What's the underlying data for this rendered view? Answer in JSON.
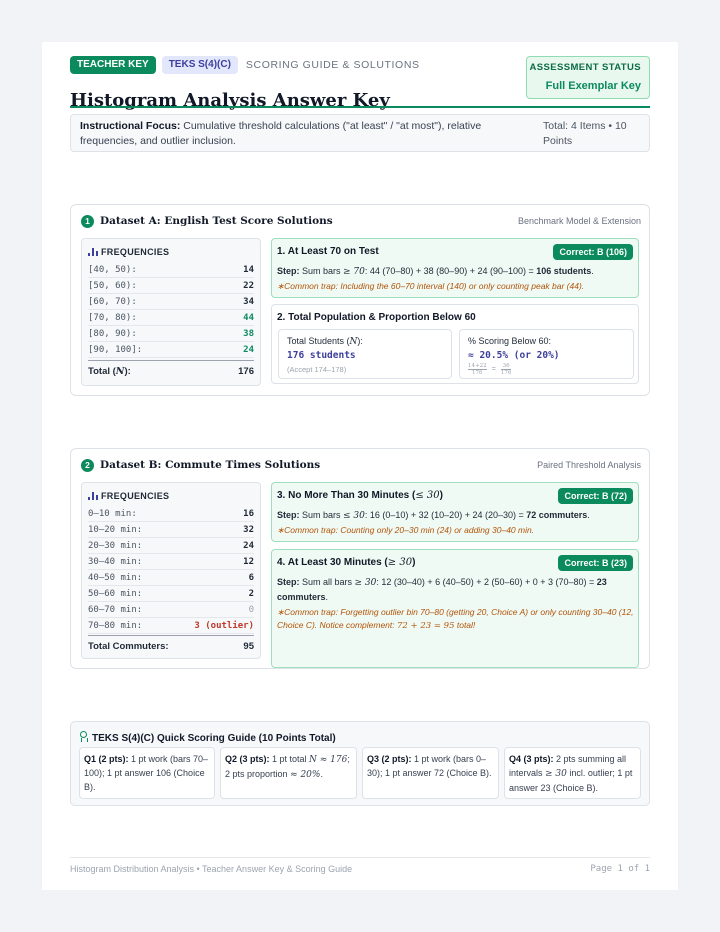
{
  "header": {
    "tag_teacher": "TEACHER KEY",
    "tag_teks": "TEKS S(4)(C)",
    "caption": "SCORING GUIDE & SOLUTIONS",
    "title": "Histogram Analysis Answer Key",
    "status_label": "ASSESSMENT STATUS",
    "status_value": "Full Exemplar Key"
  },
  "focus": {
    "label": "Instructional Focus:",
    "text": " Cumulative threshold calculations (\"at least\" / \"at most\"), relative frequencies, and outlier inclusion.",
    "total": "Total: 4 Items • 10 Points"
  },
  "colors": {
    "accent": "#0b8a5e",
    "indigo": "#3d3f9e",
    "trap": "#b45309",
    "outlier": "#c0392b"
  },
  "icons": [
    "bar-chart-icon",
    "medal-icon"
  ],
  "dataset_a": {
    "number": "1",
    "title": "Dataset A: English Test Score Solutions",
    "note": "Benchmark Model & Extension",
    "freq_heading": "FREQUENCIES",
    "rows": [
      {
        "label": "[40, 50):",
        "value": "14"
      },
      {
        "label": "[50, 60):",
        "value": "22"
      },
      {
        "label": "[60, 70):",
        "value": "34"
      },
      {
        "label": "[70, 80):",
        "value": "44"
      },
      {
        "label": "[80, 90):",
        "value": "38"
      },
      {
        "label": "[90, 100]:",
        "value": "24"
      }
    ],
    "total_label": "Total (",
    "total_var": "N",
    "total_label_end": "):",
    "total_value": "176",
    "q1": {
      "title": "1. At Least 70 on Test",
      "badge": "Correct: B (106)",
      "step_label": "Step:",
      "step_a": " Sum bars ",
      "step_math": "≥ 70",
      "step_b": ": 44 (70–80) + 38 (80–90) + 24 (90–100) = ",
      "step_result": "106 students",
      "step_end": ".",
      "trap": "∗Common trap: Including the 60–70 interval (140) or only counting peak bar (44)."
    },
    "q2": {
      "title": "2. Total Population & Proportion Below 60",
      "left_label": "Total Students (",
      "left_var": "N",
      "left_label_end": "):",
      "left_value": "176 students",
      "left_note": "(Accept 174–178)",
      "right_label": "% Scoring Below 60:",
      "right_value": "≈ 20.5% (or 20%)",
      "frac1_num": "14+22",
      "frac1_den": "176",
      "eq": "=",
      "frac2_num": "36",
      "frac2_den": "176"
    }
  },
  "dataset_b": {
    "number": "2",
    "title": "Dataset B: Commute Times Solutions",
    "note": "Paired Threshold Analysis",
    "freq_heading": "FREQUENCIES",
    "rows": [
      {
        "label": "0–10 min:",
        "value": "16"
      },
      {
        "label": "10–20 min:",
        "value": "32"
      },
      {
        "label": "20–30 min:",
        "value": "24"
      },
      {
        "label": "30–40 min:",
        "value": "12"
      },
      {
        "label": "40–50 min:",
        "value": "6"
      },
      {
        "label": "50–60 min:",
        "value": "2"
      },
      {
        "label": "60–70 min:",
        "value": "0"
      },
      {
        "label": "70–80 min:",
        "value": "3 (outlier)"
      }
    ],
    "total_label": "Total Commuters:",
    "total_value": "95",
    "q3": {
      "title": "3. No More Than 30 Minutes (",
      "title_math": "≤ 30",
      "title_end": ")",
      "badge": "Correct: B (72)",
      "step_label": "Step:",
      "step_a": " Sum bars ",
      "step_math": "≤ 30",
      "step_b": ": 16 (0–10) + 32 (10–20) + 24 (20–30) = ",
      "step_result": "72 commuters",
      "step_end": ".",
      "trap": "∗Common trap: Counting only 20–30 min (24) or adding 30–40 min."
    },
    "q4": {
      "title": "4. At Least 30 Minutes (",
      "title_math": "≥ 30",
      "title_end": ")",
      "badge": "Correct: B (23)",
      "step_label": "Step:",
      "step_a": " Sum all bars ",
      "step_math": "≥ 30",
      "step_b": ": 12 (30–40) + 6 (40–50) + 2 (50–60) + 0 + 3 (70–80) = ",
      "step_result": "23 commuters",
      "step_end": ".",
      "trap_a": "∗Common trap: Forgetting outlier bin 70–80 (getting 20, Choice A) or only counting 30–40 (12, Choice C). Notice complement: ",
      "trap_math": "72 + 23 = 95",
      "trap_b": " total!"
    }
  },
  "guide": {
    "title": "TEKS S(4)(C) Quick Scoring Guide (10 Points Total)",
    "q1_label": "Q1 (2 pts):",
    "q1_text": " 1 pt work (bars 70–100); 1 pt answer 106 (Choice B).",
    "q2_label": "Q2 (3 pts):",
    "q2_text_a": " 1 pt total ",
    "q2_math_a": "N ≈ 176",
    "q2_text_b": "; 2 pts proportion ",
    "q2_math_b": "≈ 20%",
    "q2_text_c": ".",
    "q3_label": "Q3 (2 pts):",
    "q3_text": " 1 pt work (bars 0–30); 1 pt answer 72 (Choice B).",
    "q4_label": "Q4 (3 pts):",
    "q4_text_a": " 2 pts summing all intervals ",
    "q4_math": "≥ 30",
    "q4_text_b": " incl. outlier; 1 pt answer 23 (Choice B)."
  },
  "footer": {
    "left": "Histogram Distribution Analysis • Teacher Answer Key & Scoring Guide",
    "right": "Page 1 of 1"
  }
}
